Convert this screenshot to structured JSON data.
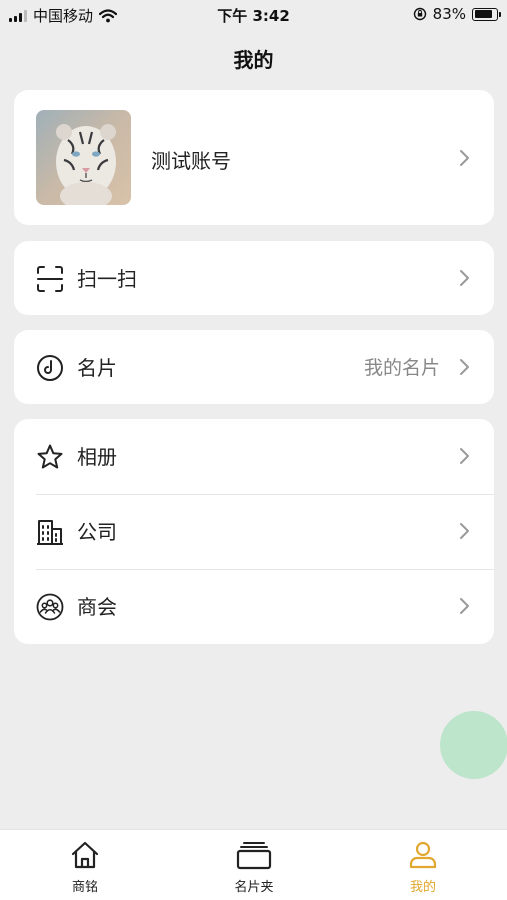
{
  "status_bar": {
    "carrier": "中国移动",
    "time": "下午 3:42",
    "battery": "83%",
    "battery_level": 0.83
  },
  "header": {
    "title": "我的"
  },
  "profile": {
    "name": "测试账号"
  },
  "menu": {
    "scan": {
      "label": "扫一扫",
      "icon": "scan-icon"
    },
    "card": {
      "label": "名片",
      "value": "我的名片",
      "icon": "card-icon"
    },
    "album": {
      "label": "相册",
      "icon": "star-icon"
    },
    "company": {
      "label": "公司",
      "icon": "building-icon"
    },
    "chamber": {
      "label": "商会",
      "icon": "people-icon"
    }
  },
  "tabbar": {
    "items": [
      {
        "label": "商铭",
        "icon": "home-icon"
      },
      {
        "label": "名片夹",
        "icon": "card-holder-icon"
      },
      {
        "label": "我的",
        "icon": "user-icon"
      }
    ],
    "active_index": 2,
    "active_color": "#e2a72e"
  },
  "colors": {
    "background": "#ededed",
    "card": "#ffffff",
    "fab": "#b6e3c6"
  }
}
